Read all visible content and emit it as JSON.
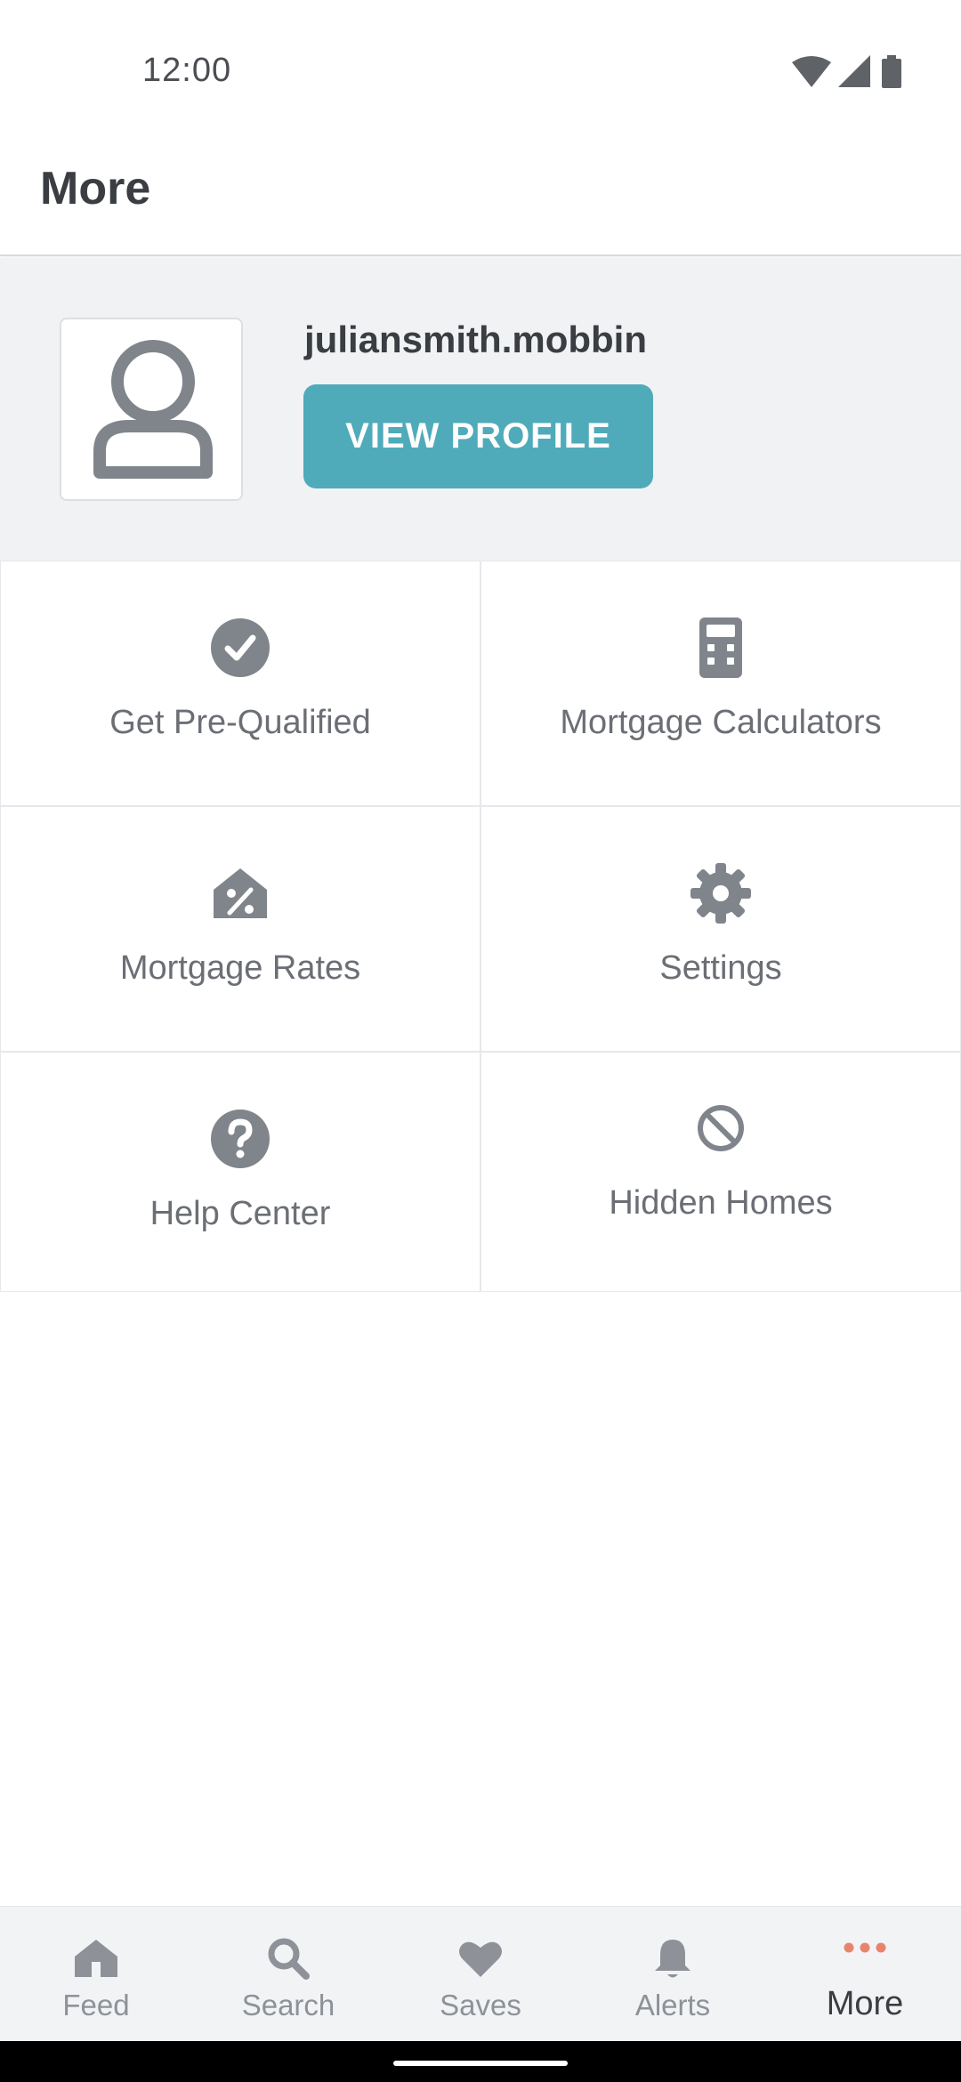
{
  "status_bar": {
    "time": "12:00"
  },
  "app_bar": {
    "title": "More"
  },
  "profile": {
    "username": "juliansmith.mobbin",
    "view_profile_label": "VIEW PROFILE"
  },
  "menu": {
    "items": [
      {
        "label": "Get Pre-Qualified",
        "icon": "check-circle-icon"
      },
      {
        "label": "Mortgage Calculators",
        "icon": "calculator-icon"
      },
      {
        "label": "Mortgage Rates",
        "icon": "house-percent-icon"
      },
      {
        "label": "Settings",
        "icon": "gear-icon"
      },
      {
        "label": "Help Center",
        "icon": "question-circle-icon"
      },
      {
        "label": "Hidden Homes",
        "icon": "prohibited-icon"
      }
    ]
  },
  "bottom_nav": {
    "items": [
      {
        "label": "Feed",
        "icon": "home-icon"
      },
      {
        "label": "Search",
        "icon": "search-icon"
      },
      {
        "label": "Saves",
        "icon": "heart-icon"
      },
      {
        "label": "Alerts",
        "icon": "bell-icon"
      },
      {
        "label": "More",
        "icon": "more-dots-icon",
        "active": true
      }
    ],
    "active_color": "#e8846b"
  },
  "colors": {
    "accent": "#4fabba",
    "icon_gray": "#80858c",
    "text_dark": "#3a3d41"
  }
}
